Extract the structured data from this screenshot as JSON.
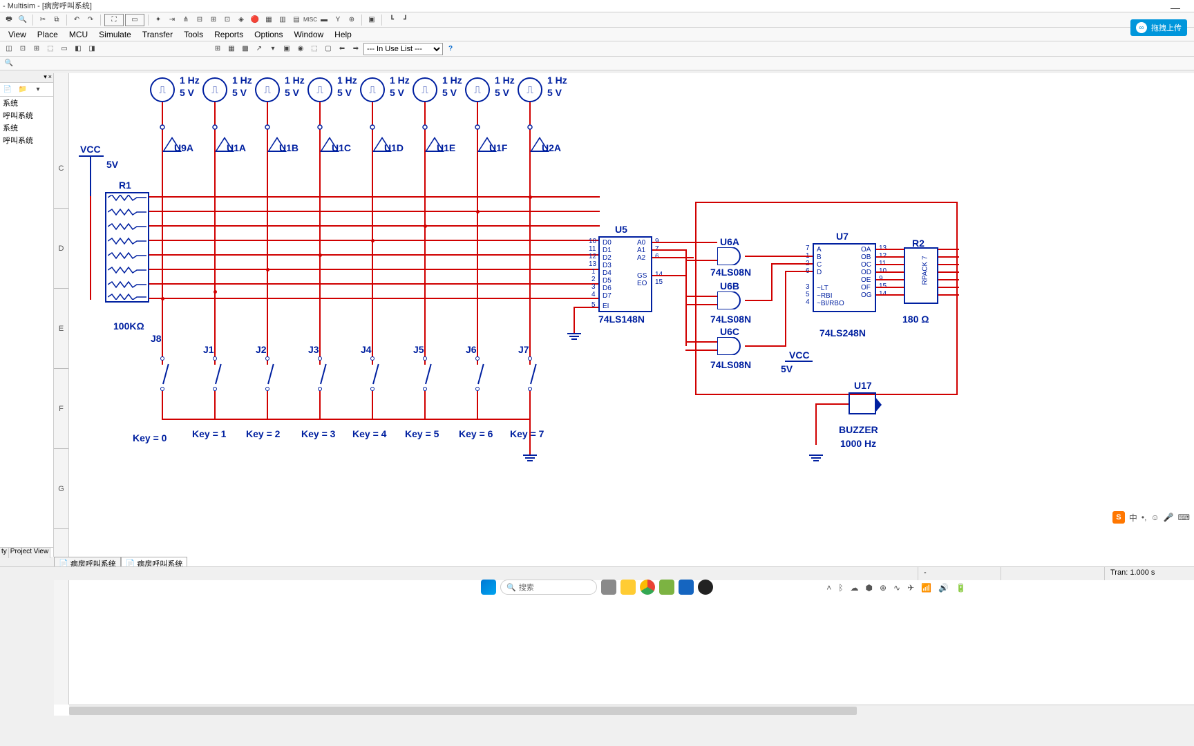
{
  "window": {
    "title": "- Multisim - [病房呼叫系统]"
  },
  "menus": [
    "View",
    "Place",
    "MCU",
    "Simulate",
    "Transfer",
    "Tools",
    "Reports",
    "Options",
    "Window",
    "Help"
  ],
  "inuse_label": "--- In Use List ---",
  "cloud": {
    "label": "拖拽上传"
  },
  "left_items": [
    "系统",
    "呼叫系统",
    "系统",
    "呼叫系统"
  ],
  "left_tabs": [
    "ty",
    "Project View"
  ],
  "ruler_rows": [
    "C",
    "D",
    "E",
    "F",
    "G"
  ],
  "vcc": {
    "label": "VCC",
    "value": "5V"
  },
  "vcc2": {
    "label": "VCC",
    "value": "5V"
  },
  "r1": {
    "name": "R1",
    "value": "100KΩ"
  },
  "r2": {
    "name": "R2",
    "value": "180 Ω",
    "type": "RPACK 7"
  },
  "clock_labels": {
    "freq": "1 Hz",
    "volt": "5 V"
  },
  "buffers": [
    "U9A",
    "U1A",
    "U1B",
    "U1C",
    "U1D",
    "U1E",
    "U1F",
    "U2A"
  ],
  "switches": [
    {
      "name": "J8",
      "key": "Key = 0"
    },
    {
      "name": "J1",
      "key": "Key = 1"
    },
    {
      "name": "J2",
      "key": "Key = 2"
    },
    {
      "name": "J3",
      "key": "Key = 3"
    },
    {
      "name": "J4",
      "key": "Key = 4"
    },
    {
      "name": "J5",
      "key": "Key = 5"
    },
    {
      "name": "J6",
      "key": "Key = 6"
    },
    {
      "name": "J7",
      "key": "Key = 7"
    }
  ],
  "u5": {
    "name": "U5",
    "part": "74LS148N",
    "left_pins": [
      "D0",
      "D1",
      "D2",
      "D3",
      "D4",
      "D5",
      "D6",
      "D7",
      "EI"
    ],
    "right_pins": [
      "A0",
      "A1",
      "A2",
      "GS",
      "EO"
    ],
    "left_nums": [
      "10",
      "11",
      "12",
      "13",
      "1",
      "2",
      "3",
      "4",
      "5"
    ],
    "right_nums": [
      "9",
      "7",
      "6",
      "14",
      "15"
    ]
  },
  "u6": {
    "a": "U6A",
    "b": "U6B",
    "c": "U6C",
    "part": "74LS08N"
  },
  "u7": {
    "name": "U7",
    "part": "74LS248N",
    "left_pins": [
      "A",
      "B",
      "C",
      "D",
      "~LT",
      "~RBI",
      "~BI/RBO"
    ],
    "right_pins": [
      "OA",
      "OB",
      "OC",
      "OD",
      "OE",
      "OF",
      "OG"
    ],
    "left_nums": [
      "7",
      "1",
      "2",
      "6",
      "3",
      "5",
      "4"
    ],
    "right_nums": [
      "13",
      "12",
      "11",
      "10",
      "9",
      "15",
      "14"
    ]
  },
  "u17": {
    "name": "U17",
    "label": "BUZZER",
    "freq": "1000 Hz"
  },
  "doctabs": [
    "病房呼叫系统",
    "病房呼叫系统"
  ],
  "status": {
    "tran": "Tran: 1.000 s"
  },
  "search_placeholder": "搜索",
  "tray_text": "中"
}
